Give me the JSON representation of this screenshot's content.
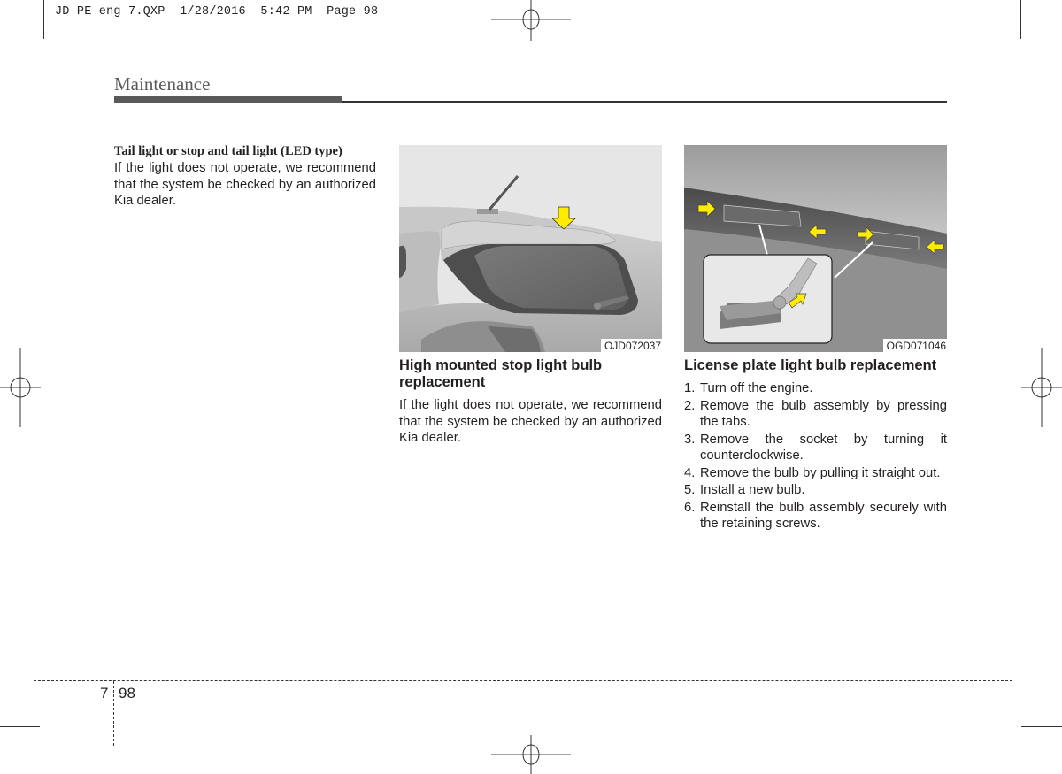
{
  "slug": {
    "text": "JD PE eng 7.QXP  1/28/2016  5:42 PM  Page 98"
  },
  "header": {
    "section_title": "Maintenance"
  },
  "column1": {
    "heading": "Tail light or stop and tail light (LED type)",
    "body": "If the light does not operate, we recommend that the system be checked by an authorized Kia dealer."
  },
  "figures": [
    {
      "code": "OJD072037",
      "description": "Rear of hatchback with yellow arrow pointing to high mounted stop light on spoiler",
      "arrow_color": "#ffec00"
    },
    {
      "code": "OGD071046",
      "description": "License plate lights on tailgate with yellow arrows indicating tabs; inset shows bulb removal from socket",
      "arrow_color": "#ffec00"
    }
  ],
  "column2": {
    "heading": "High mounted stop light bulb replacement",
    "body": "If the light does not operate, we recommend that the system be checked by an authorized Kia dealer."
  },
  "column3": {
    "heading": "License plate light bulb replacement",
    "steps": [
      {
        "num": "1.",
        "text": "Turn off the engine."
      },
      {
        "num": "2.",
        "text": "Remove the bulb assembly by pressing the tabs."
      },
      {
        "num": "3.",
        "text": "Remove the socket by turning it counterclockwise."
      },
      {
        "num": "4.",
        "text": "Remove the bulb by pulling it straight out."
      },
      {
        "num": "5.",
        "text": "Install a new bulb."
      },
      {
        "num": "6.",
        "text": "Reinstall the bulb assembly securely with the retaining screws."
      }
    ]
  },
  "footer": {
    "chapter": "7",
    "page": "98"
  }
}
